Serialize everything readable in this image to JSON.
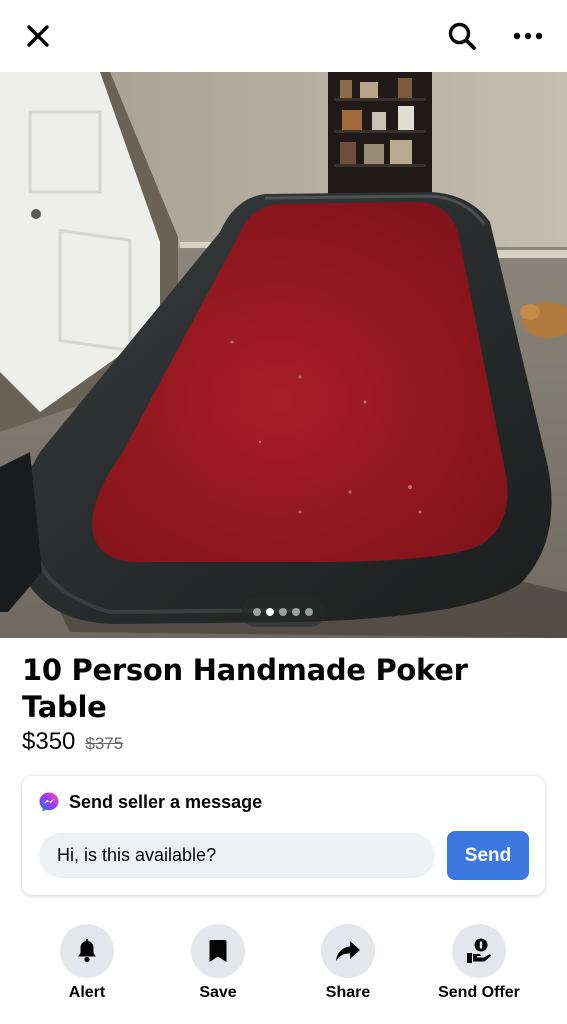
{
  "header": {
    "close_icon": "close-icon",
    "search_icon": "search-icon",
    "more_icon": "more-icon"
  },
  "listing": {
    "photo_pager": {
      "total": 5,
      "current": 2
    },
    "title": "10 Person Handmade Poker Table",
    "price": "$350",
    "original_price": "$375"
  },
  "message": {
    "heading": "Send seller a message",
    "input_value": "Hi, is this available?",
    "send_label": "Send",
    "icon": "messenger-icon"
  },
  "actions": [
    {
      "label": "Alert",
      "icon": "bell-icon"
    },
    {
      "label": "Save",
      "icon": "bookmark-icon"
    },
    {
      "label": "Share",
      "icon": "share-arrow-icon"
    },
    {
      "label": "Send Offer",
      "icon": "offer-hand-icon"
    }
  ],
  "colors": {
    "send_button": "#3b78e0",
    "table_felt": "#9c1a22",
    "action_circle": "#e4e6eb"
  }
}
